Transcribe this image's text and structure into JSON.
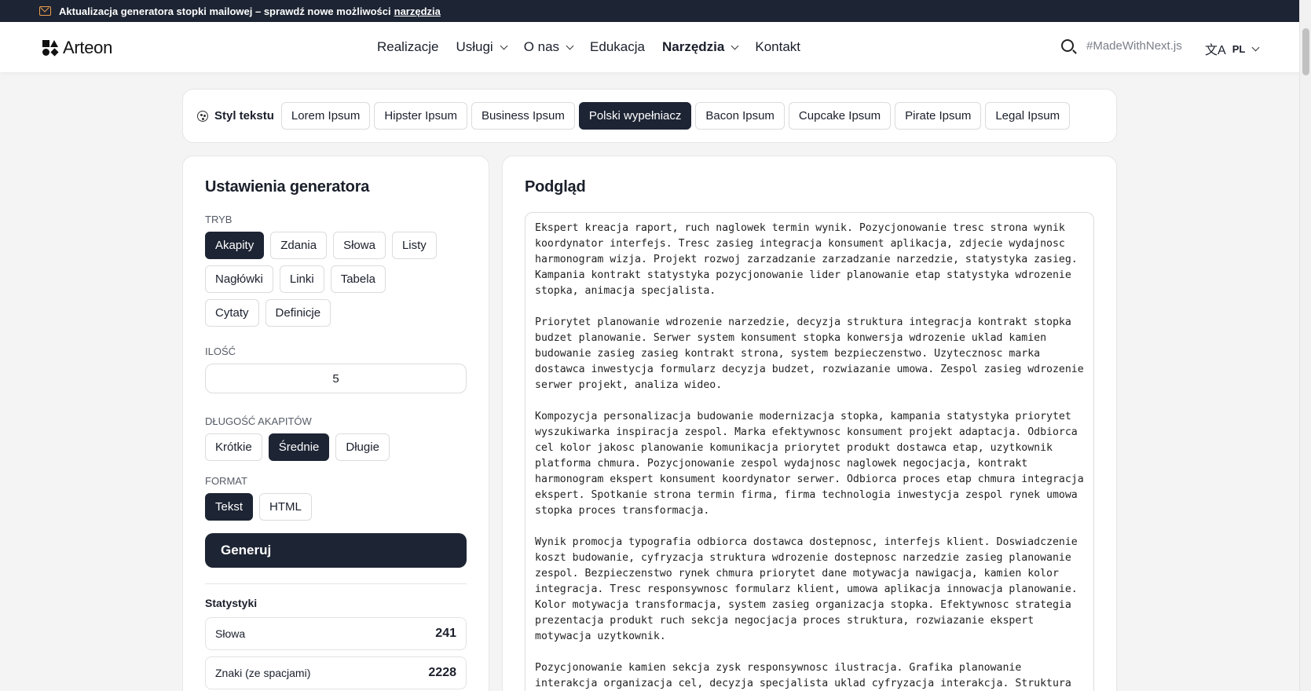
{
  "announcement": {
    "text": "Aktualizacja generatora stopki mailowej – sprawdź nowe możliwości",
    "link": "narzędzia"
  },
  "header": {
    "logo": "Arteon",
    "nav": [
      {
        "label": "Realizacje"
      },
      {
        "label": "Usługi"
      },
      {
        "label": "O nas"
      },
      {
        "label": "Edukacja"
      },
      {
        "label": "Narzędzia"
      },
      {
        "label": "Kontakt"
      }
    ],
    "made_with": "#MadeWithNext.js",
    "lang": "PL"
  },
  "style_selector": {
    "label": "Styl tekstu",
    "options": [
      "Lorem Ipsum",
      "Hipster Ipsum",
      "Business Ipsum",
      "Polski wypełniacz",
      "Bacon Ipsum",
      "Cupcake Ipsum",
      "Pirate Ipsum",
      "Legal Ipsum"
    ],
    "selected": "Polski wypełniacz"
  },
  "settings": {
    "title": "Ustawienia generatora",
    "mode_label": "Tryb",
    "modes": [
      "Akapity",
      "Zdania",
      "Słowa",
      "Listy",
      "Nagłówki",
      "Linki",
      "Tabela",
      "Cytaty",
      "Definicje"
    ],
    "mode_selected": "Akapity",
    "quantity_label": "Ilość",
    "quantity_value": "5",
    "length_label": "Długość akapitów",
    "lengths": [
      "Krótkie",
      "Średnie",
      "Długie"
    ],
    "length_selected": "Średnie",
    "format_label": "Format",
    "formats": [
      "Tekst",
      "HTML"
    ],
    "format_selected": "Tekst",
    "generate_label": "Generuj",
    "stats_title": "Statystyki",
    "stats": [
      {
        "label": "Słowa",
        "value": "241"
      },
      {
        "label": "Znaki (ze spacjami)",
        "value": "2228"
      }
    ]
  },
  "preview": {
    "title": "Podgląd",
    "paragraphs": [
      "Ekspert kreacja raport, ruch naglowek termin wynik. Pozycjonowanie tresc strona wynik koordynator interfejs. Tresc zasieg integracja konsument aplikacja, zdjecie wydajnosc harmonogram wizja. Projekt rozwoj zarzadzanie zarzadzanie narzedzie, statystyka zasieg. Kampania kontrakt statystyka pozycjonowanie lider planowanie etap statystyka wdrozenie stopka, animacja specjalista.",
      "Priorytet planowanie wdrozenie narzedzie, decyzja struktura integracja kontrakt stopka budzet planowanie. Serwer system konsument stopka konwersja wdrozenie uklad kamien budowanie zasieg zasieg kontrakt strona, system bezpieczenstwo. Uzytecznosc marka dostawca inwestycja formularz decyzja budzet, rozwiazanie umowa. Zespol zasieg wdrozenie serwer projekt, analiza wideo.",
      "Kompozycja personalizacja budowanie modernizacja stopka, kampania statystyka priorytet wyszukiwarka inspiracja zespol. Marka efektywnosc konsument projekt adaptacja. Odbiorca cel kolor jakosc planowanie komunikacja priorytet produkt dostawca etap, uzytkownik platforma chmura. Pozycjonowanie zespol wydajnosc naglowek negocjacja, kontrakt harmonogram ekspert konsument koordynator serwer. Odbiorca proces etap chmura integracja ekspert. Spotkanie strona termin firma, firma technologia inwestycja zespol rynek umowa stopka proces transformacja.",
      "Wynik promocja typografia odbiorca dostawca dostepnosc, interfejs klient. Doswiadczenie koszt budowanie, cyfryzacja struktura wdrozenie dostepnosc narzedzie zasieg planowanie zespol. Bezpieczenstwo rynek chmura priorytet dane motywacja nawigacja, kamien kolor integracja. Tresc responsywnosc formularz klient, umowa aplikacja innowacja planowanie. Kolor motywacja transformacja, system zasieg organizacja stopka. Efektywnosc strategia prezentacja produkt ruch sekcja negocjacja proces struktura, rozwiazanie ekspert motywacja uzytkownik.",
      "Pozycjonowanie kamien sekcja zysk responsywnosc ilustracja. Grafika planowanie interakcja organizacja cel, decyzja specjalista uklad cyfryzacja interakcja. Struktura wydajnosc"
    ]
  }
}
